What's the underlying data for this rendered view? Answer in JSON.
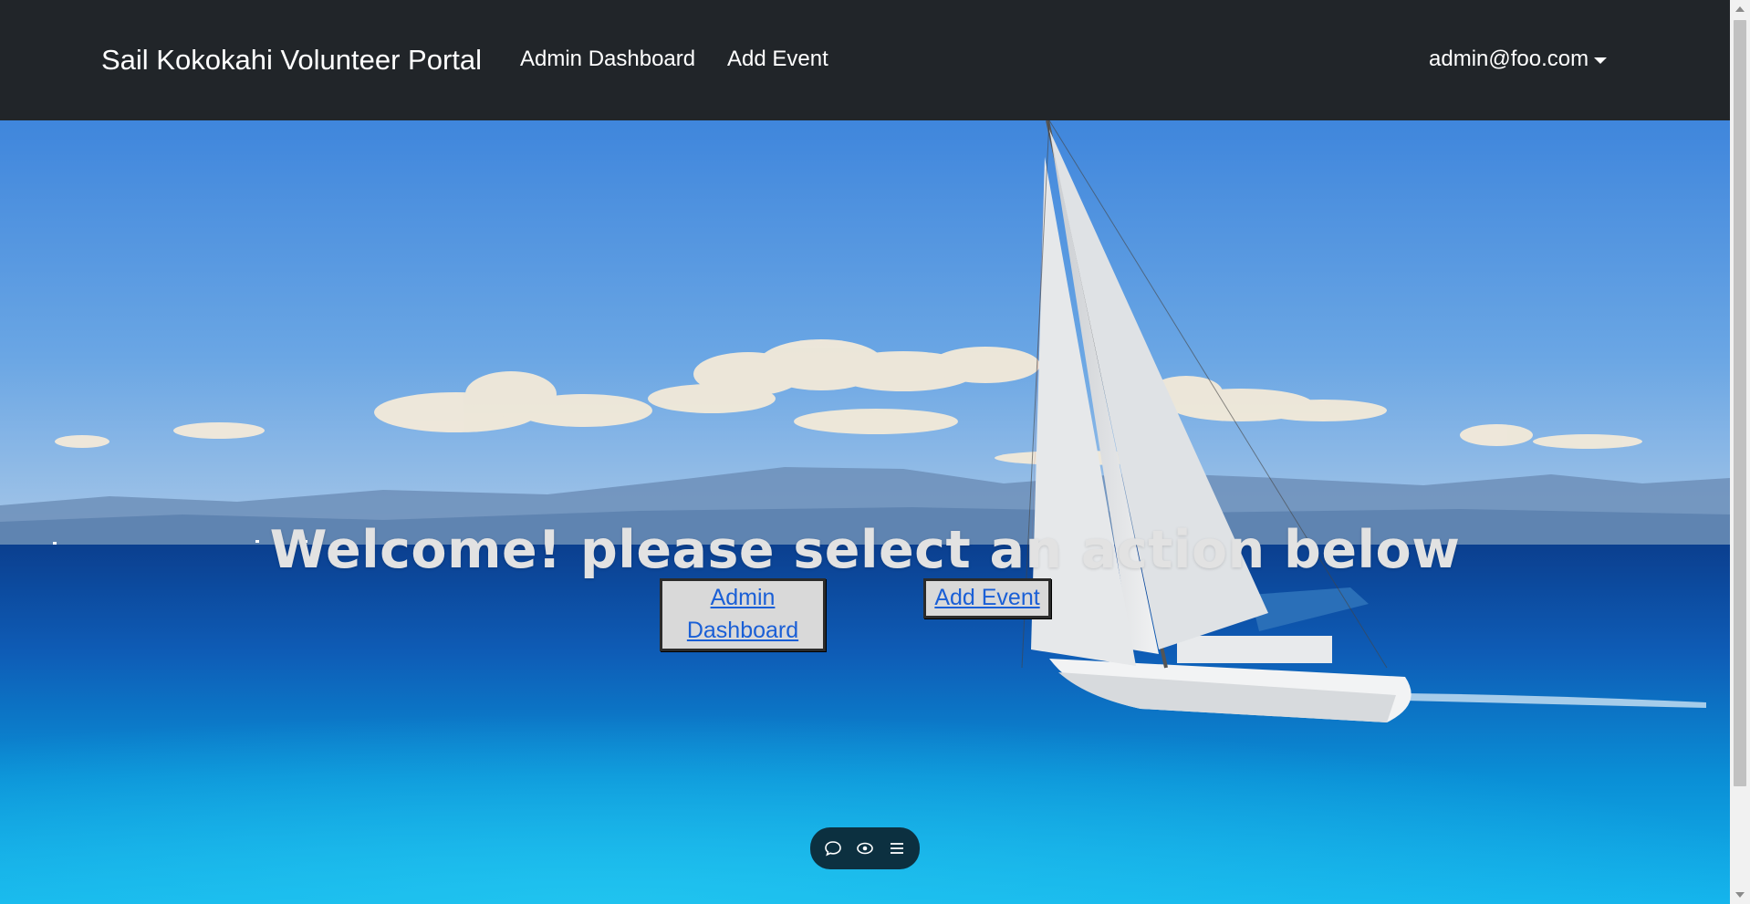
{
  "navbar": {
    "brand": "Sail Kokokahi Volunteer Portal",
    "links": [
      {
        "label": "Admin Dashboard"
      },
      {
        "label": "Add Event"
      }
    ],
    "user": "admin@foo.com"
  },
  "hero": {
    "heading": "Welcome! please select an action below",
    "buttons": [
      {
        "label": "Admin Dashboard"
      },
      {
        "label": "Add Event"
      }
    ],
    "background_image": "sailboat on blue ocean with clouds"
  },
  "toolbar": {
    "icons": [
      "chat-icon",
      "eye-icon",
      "menu-icon"
    ]
  },
  "colors": {
    "navbar_bg": "#212529",
    "link": "#1a5fd6",
    "button_bg": "#d9d9d9",
    "toolbar_bg": "#0c3040"
  }
}
